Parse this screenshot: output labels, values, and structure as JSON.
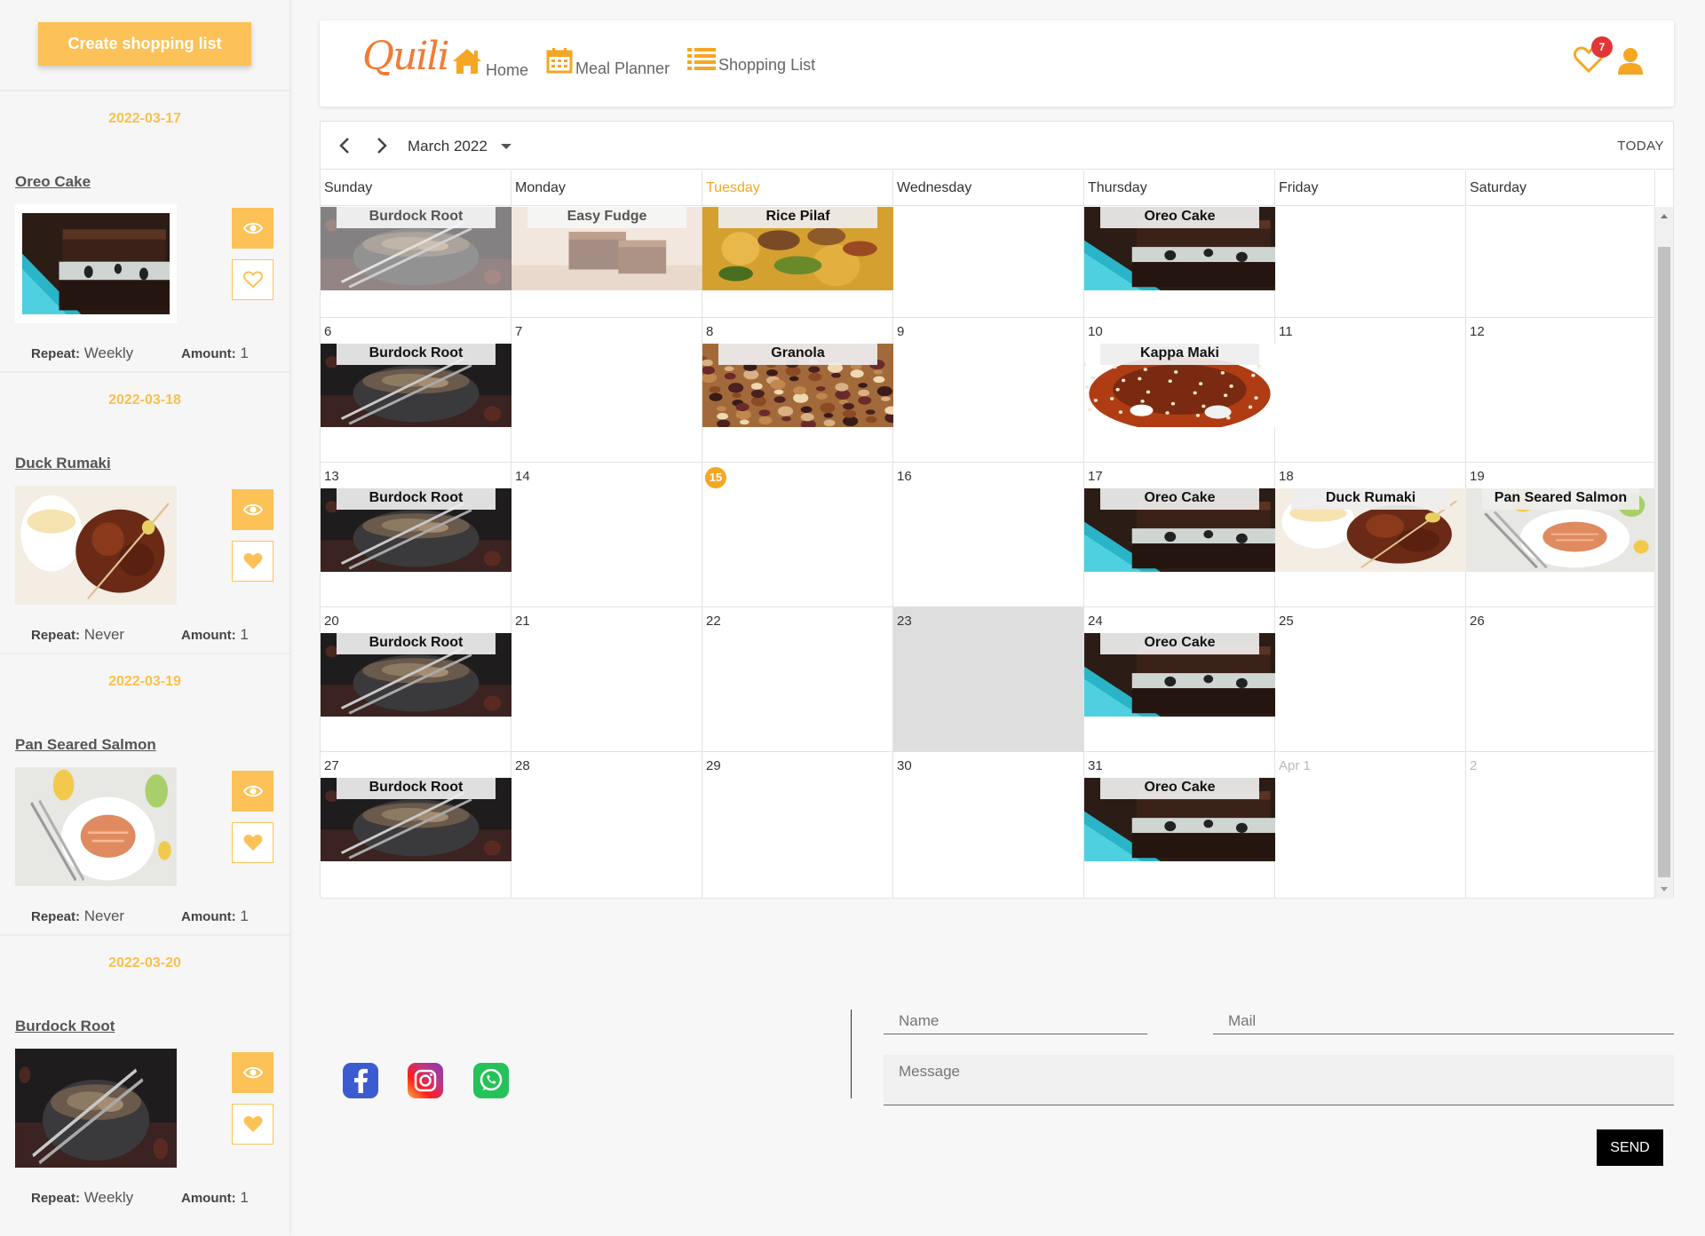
{
  "sidebar": {
    "create_button": "Create shopping list",
    "cards": [
      {
        "date": "2022-03-17",
        "title": "Oreo Cake",
        "repeat_label": "Repeat:",
        "repeat": "Weekly",
        "amount_label": "Amount:",
        "amount": "1",
        "image": "oreo-cake-image",
        "favorited": false
      },
      {
        "date": "2022-03-18",
        "title": "Duck Rumaki",
        "repeat_label": "Repeat:",
        "repeat": "Never",
        "amount_label": "Amount:",
        "amount": "1",
        "image": "duck-rumaki-image",
        "favorited": true
      },
      {
        "date": "2022-03-19",
        "title": "Pan Seared Salmon",
        "repeat_label": "Repeat:",
        "repeat": "Never",
        "amount_label": "Amount:",
        "amount": "1",
        "image": "pan-seared-salmon-image",
        "favorited": true
      },
      {
        "date": "2022-03-20",
        "title": "Burdock Root",
        "repeat_label": "Repeat:",
        "repeat": "Weekly",
        "amount_label": "Amount:",
        "amount": "1",
        "image": "burdock-root-image",
        "favorited": true
      }
    ]
  },
  "navbar": {
    "logo": "Quili",
    "items": [
      {
        "label": "Home",
        "icon": "home-icon"
      },
      {
        "label": "Meal Planner",
        "icon": "calendar-icon"
      },
      {
        "label": "Shopping List",
        "icon": "list-icon"
      }
    ],
    "favorites_count": "7",
    "accent": "#f5a623"
  },
  "calendar": {
    "month_label": "March 2022",
    "today_label": "TODAY",
    "days_of_week": [
      "Sunday",
      "Monday",
      "Tuesday",
      "Wednesday",
      "Thursday",
      "Friday",
      "Saturday"
    ],
    "today_column": "Tuesday",
    "today_date": "15",
    "weeks": [
      {
        "days": [
          {
            "num": "",
            "event": "Burdock Root",
            "faded": true
          },
          {
            "num": "",
            "event": "Easy Fudge",
            "faded": true
          },
          {
            "num": "",
            "event": "Rice Pilaf"
          },
          {
            "num": ""
          },
          {
            "num": "",
            "event": "Oreo Cake"
          },
          {
            "num": ""
          },
          {
            "num": ""
          }
        ]
      },
      {
        "days": [
          {
            "num": "6",
            "event": "Burdock Root"
          },
          {
            "num": "7"
          },
          {
            "num": "8",
            "event": "Granola"
          },
          {
            "num": "9"
          },
          {
            "num": "10",
            "event": "Kappa Maki"
          },
          {
            "num": "11"
          },
          {
            "num": "12"
          }
        ]
      },
      {
        "days": [
          {
            "num": "13",
            "event": "Burdock Root"
          },
          {
            "num": "14"
          },
          {
            "num": "15",
            "today": true
          },
          {
            "num": "16"
          },
          {
            "num": "17",
            "event": "Oreo Cake"
          },
          {
            "num": "18",
            "event": "Duck Rumaki"
          },
          {
            "num": "19",
            "event": "Pan Seared Salmon"
          }
        ]
      },
      {
        "days": [
          {
            "num": "20",
            "event": "Burdock Root"
          },
          {
            "num": "21"
          },
          {
            "num": "22"
          },
          {
            "num": "23",
            "highlight": true
          },
          {
            "num": "24",
            "event": "Oreo Cake"
          },
          {
            "num": "25"
          },
          {
            "num": "26"
          }
        ]
      },
      {
        "days": [
          {
            "num": "27",
            "event": "Burdock Root"
          },
          {
            "num": "28"
          },
          {
            "num": "29"
          },
          {
            "num": "30"
          },
          {
            "num": "31",
            "event": "Oreo Cake"
          },
          {
            "num": "Apr 1",
            "other": true
          },
          {
            "num": "2",
            "other": true
          }
        ]
      }
    ]
  },
  "footer": {
    "social": [
      "facebook-icon",
      "instagram-icon",
      "whatsapp-icon"
    ],
    "name_placeholder": "Name",
    "mail_placeholder": "Mail",
    "message_placeholder": "Message",
    "send_label": "SEND"
  }
}
